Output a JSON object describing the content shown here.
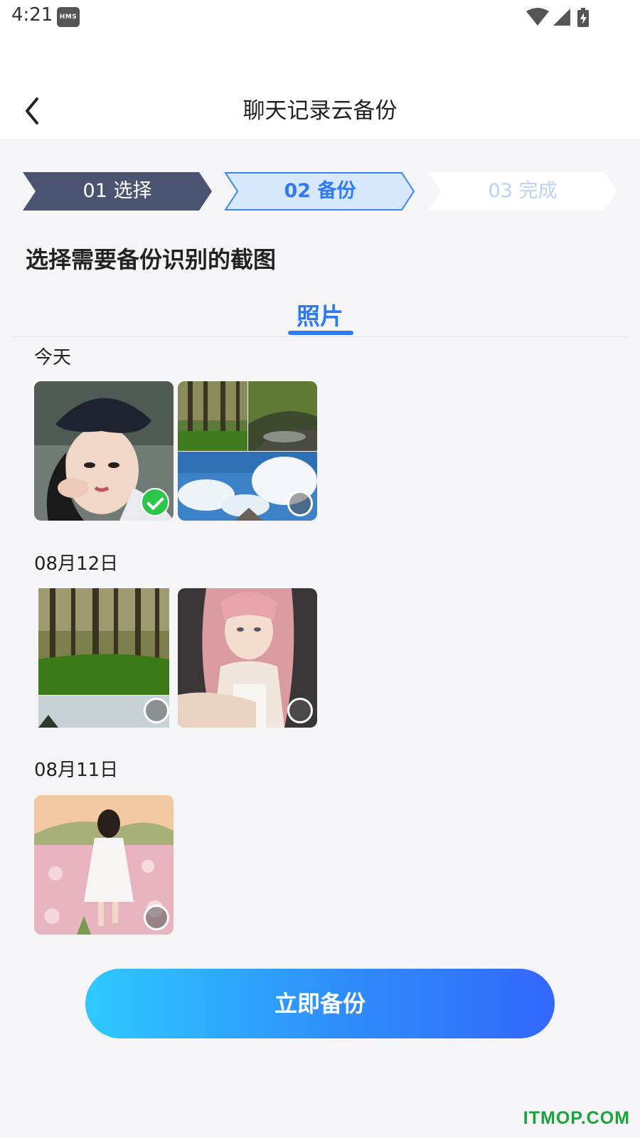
{
  "status_bar": {
    "time": "4:21",
    "badge": "HMS",
    "icons": [
      "wifi-icon",
      "signal-icon",
      "battery-charging-icon"
    ]
  },
  "header": {
    "title": "聊天记录云备份",
    "back_icon": "chevron-left-icon"
  },
  "steps": [
    {
      "label": "01  选择",
      "state": "done"
    },
    {
      "label": "02  备份",
      "state": "active"
    },
    {
      "label": "03  完成",
      "state": "pending"
    }
  ],
  "section_title": "选择需要备份识别的截图",
  "tabs": [
    {
      "label": "照片",
      "active": true
    }
  ],
  "groups": [
    {
      "date": "今天",
      "photos": [
        {
          "subject": "portrait-girl-hat",
          "selected": true
        },
        {
          "subject": "forest-river-sky-collage",
          "selected": false
        }
      ]
    },
    {
      "date": "08月12日",
      "photos": [
        {
          "subject": "forest-moss",
          "selected": false
        },
        {
          "subject": "pink-hair-girl",
          "selected": false
        }
      ]
    },
    {
      "date": "08月11日",
      "photos": [
        {
          "subject": "girl-flower-field",
          "selected": false
        }
      ]
    }
  ],
  "action_button": {
    "label": "立即备份"
  },
  "watermark": "ITMOP.COM",
  "colors": {
    "accent": "#2f7af0",
    "step_done": "#4a5370",
    "check": "#2cc64a"
  }
}
